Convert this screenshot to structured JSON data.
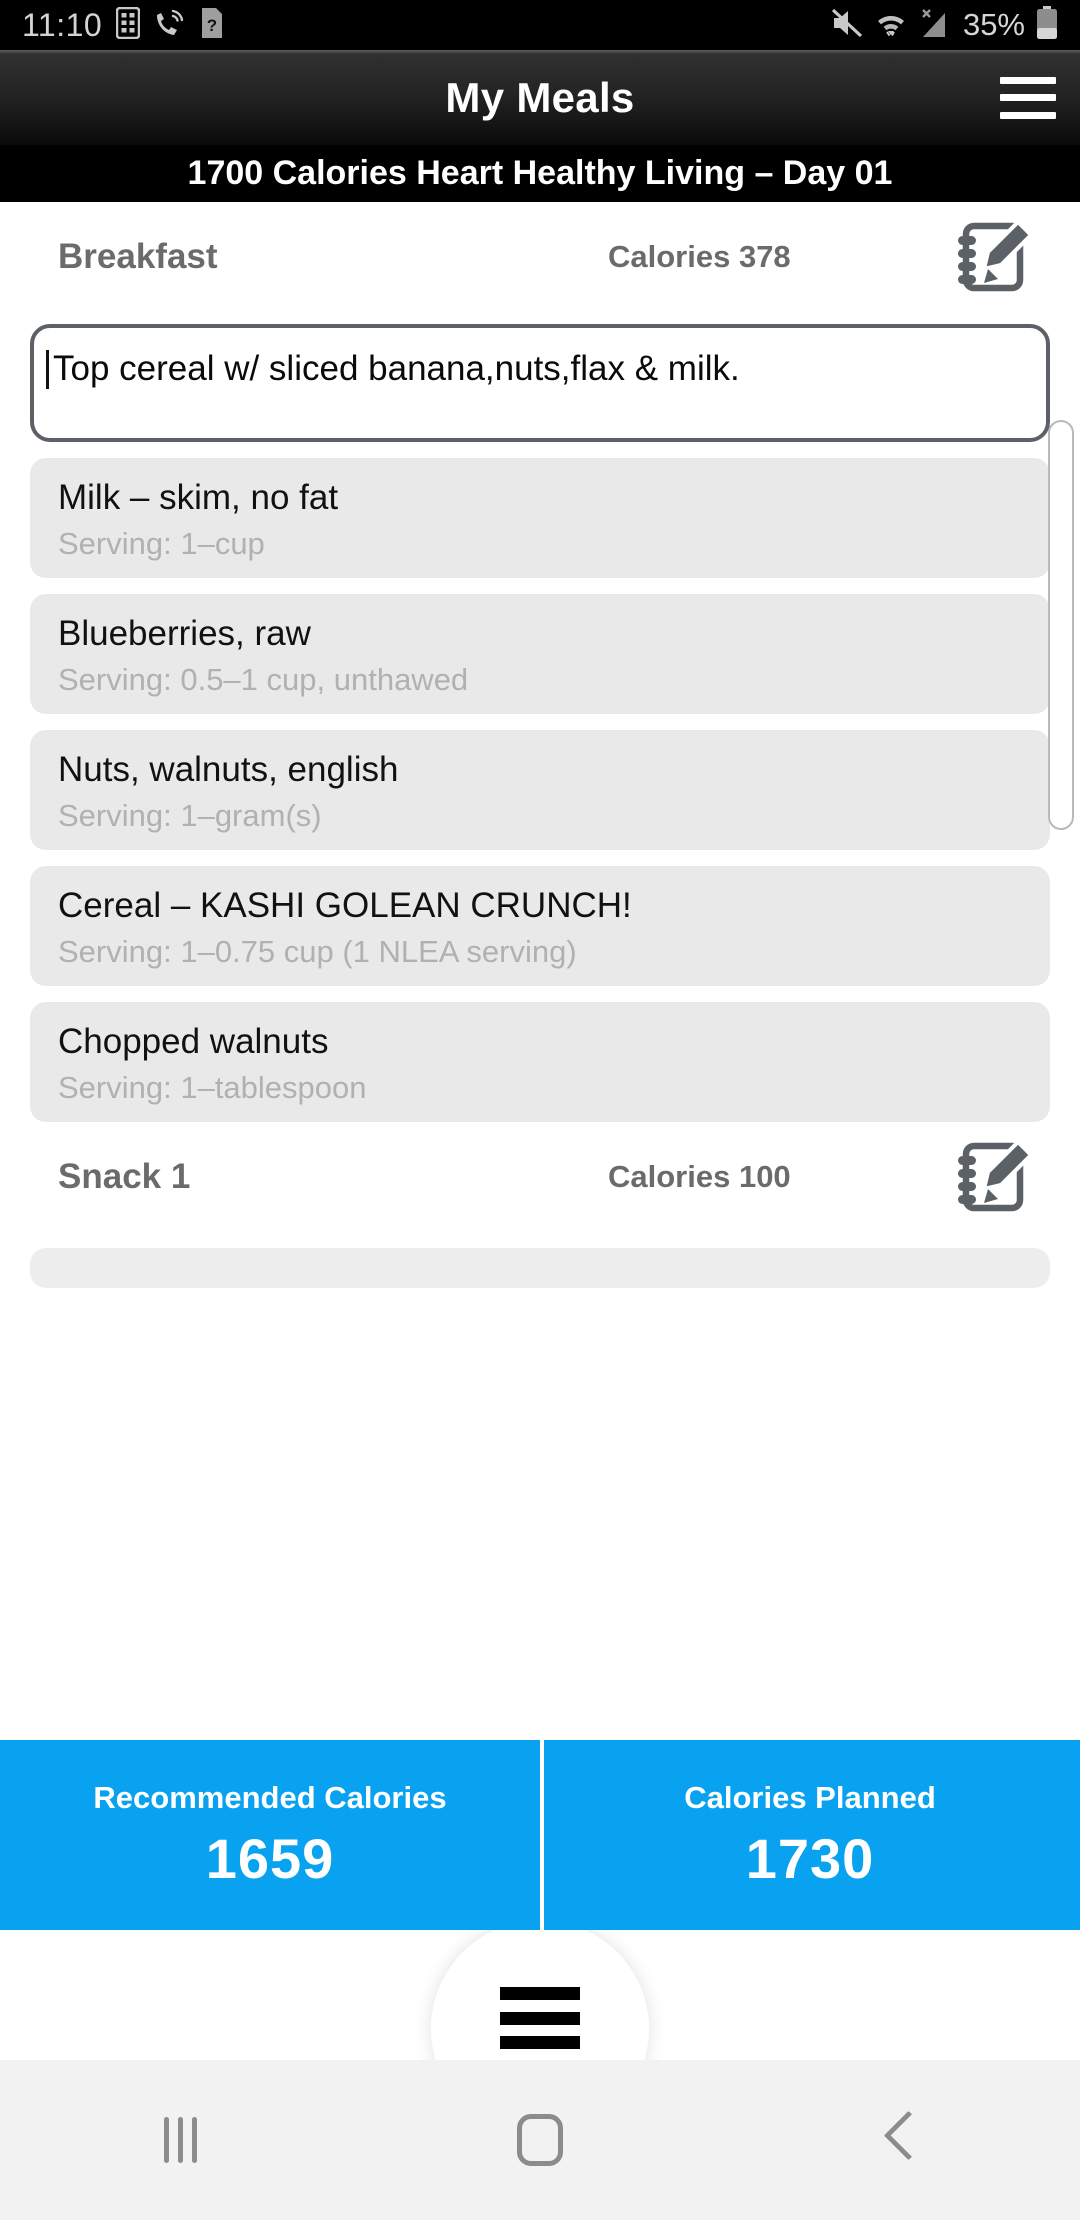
{
  "status_bar": {
    "time": "11:10",
    "battery_percent": "35%",
    "left_icons": [
      "calculator-icon",
      "wifi-calling-icon",
      "sim-unknown-icon"
    ],
    "right_icons": [
      "mute-icon",
      "wifi-icon",
      "no-signal-icon",
      "battery-icon"
    ]
  },
  "header": {
    "title": "My Meals",
    "menu_icon": "hamburger-icon",
    "subtitle": "1700  Calories Heart Healthy Living – Day 01"
  },
  "meals": [
    {
      "name": "Breakfast",
      "calories_label": "Calories 378",
      "edit_icon": "note-edit-icon",
      "note": "Top cereal w/ sliced banana,nuts,flax & milk.",
      "foods": [
        {
          "name": "Milk – skim, no fat",
          "serving": "Serving: 1–cup"
        },
        {
          "name": "Blueberries, raw",
          "serving": "Serving: 0.5–1 cup, unthawed"
        },
        {
          "name": "Nuts, walnuts, english",
          "serving": "Serving: 1–gram(s)"
        },
        {
          "name": "Cereal – KASHI GOLEAN CRUNCH!",
          "serving": "Serving: 1–0.75 cup (1 NLEA serving)"
        },
        {
          "name": "Chopped walnuts",
          "serving": "Serving: 1–tablespoon"
        }
      ]
    },
    {
      "name": "Snack 1",
      "calories_label": "Calories 100",
      "edit_icon": "note-edit-icon",
      "note": "",
      "foods": []
    }
  ],
  "summary": {
    "recommended": {
      "label": "Recommended Calories",
      "value": "1659"
    },
    "planned": {
      "label": "Calories Planned",
      "value": "1730"
    }
  },
  "drawer": {
    "handle_icon": "hamburger-icon"
  },
  "nav_bar": {
    "recents": "recents-icon",
    "home": "home-icon",
    "back": "back-icon"
  },
  "colors": {
    "accent_blue": "#09a2f0",
    "header_black": "#000000",
    "card_grey": "#e9e9e9",
    "muted_text": "#b1b1b1",
    "meal_label": "#6b6b6b"
  }
}
